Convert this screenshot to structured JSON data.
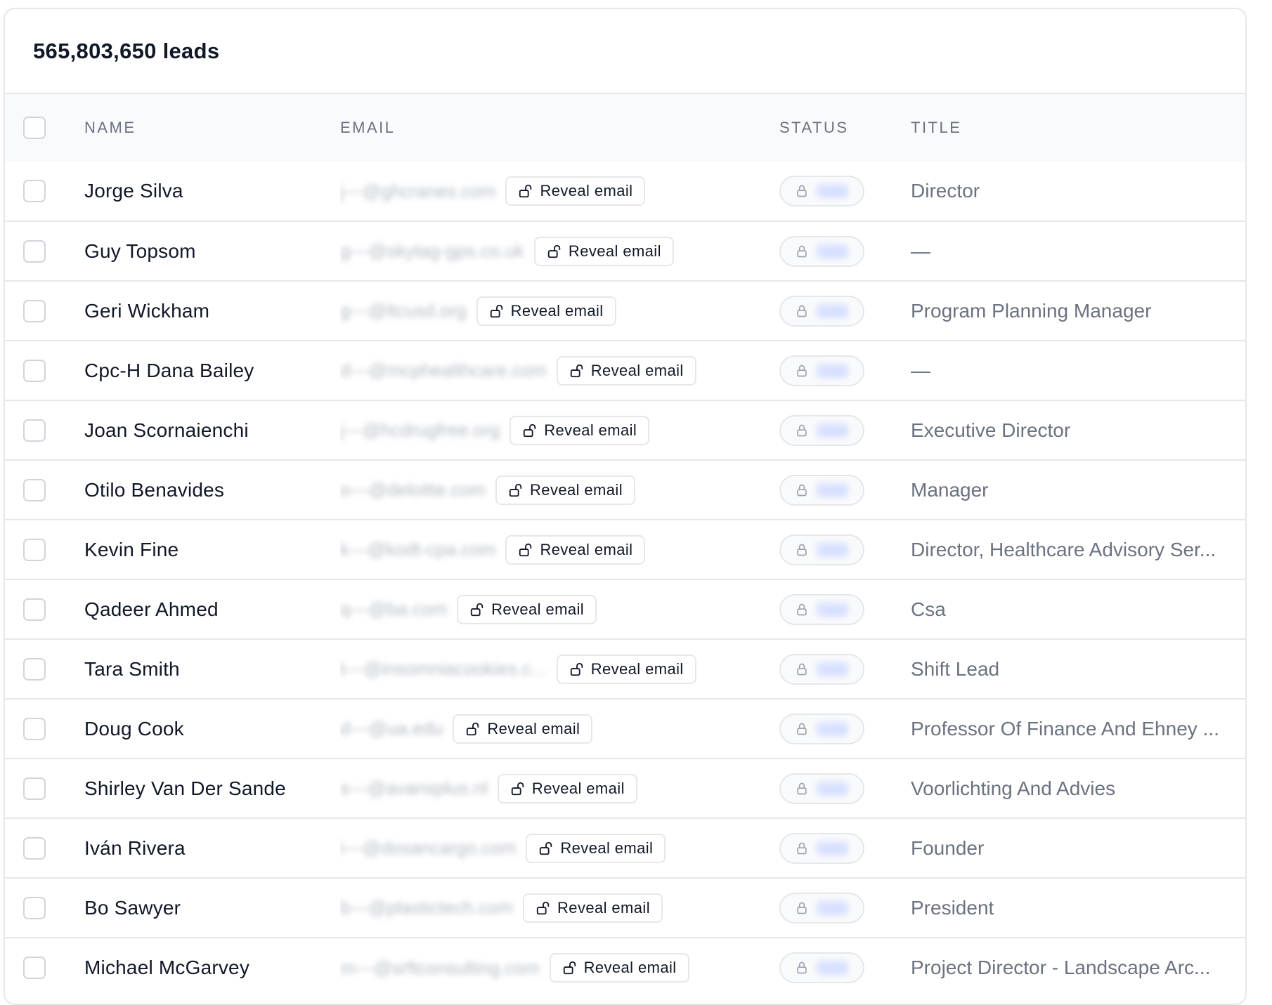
{
  "header": {
    "lead_count": "565,803,650 leads"
  },
  "columns": {
    "name": "NAME",
    "email": "EMAIL",
    "status": "STATUS",
    "title": "TITLE"
  },
  "reveal_label": "Reveal email",
  "rows": [
    {
      "name": "Jorge Silva",
      "email": "j---@ghcranes.com",
      "status": "Valid",
      "title": "Director"
    },
    {
      "name": "Guy Topsom",
      "email": "g---@skytag-gps.co.uk",
      "status": "Valid",
      "title": "—"
    },
    {
      "name": "Geri Wickham",
      "email": "g---@ltcusd.org",
      "status": "Valid",
      "title": "Program Planning Manager"
    },
    {
      "name": "Cpc-H Dana Bailey",
      "email": "d---@mcphealthcare.com",
      "status": "Valid",
      "title": "—"
    },
    {
      "name": "Joan Scornaienchi",
      "email": "j---@hcdrugfree.org",
      "status": "Valid",
      "title": "Executive Director"
    },
    {
      "name": "Otilo Benavides",
      "email": "o---@deloitte.com",
      "status": "Valid",
      "title": "Manager"
    },
    {
      "name": "Kevin Fine",
      "email": "k---@kodt-cpa.com",
      "status": "Valid",
      "title": "Director, Healthcare Advisory Ser..."
    },
    {
      "name": "Qadeer Ahmed",
      "email": "q---@ba.com",
      "status": "Valid",
      "title": "Csa"
    },
    {
      "name": "Tara Smith",
      "email": "t---@insomniacookies.c...",
      "status": "Valid",
      "title": "Shift Lead"
    },
    {
      "name": "Doug Cook",
      "email": "d---@ua.edu",
      "status": "Valid",
      "title": "Professor Of Finance And Ehney ..."
    },
    {
      "name": "Shirley Van Der Sande",
      "email": "s---@avansplus.nl",
      "status": "Valid",
      "title": "Voorlichting And Advies"
    },
    {
      "name": "Iván Rivera",
      "email": "i---@dosancargo.com",
      "status": "Valid",
      "title": "Founder"
    },
    {
      "name": "Bo Sawyer",
      "email": "b---@plastictech.com",
      "status": "Valid",
      "title": "President"
    },
    {
      "name": "Michael McGarvey",
      "email": "m---@srftconsulting.com",
      "status": "Valid",
      "title": "Project Director - Landscape Arc..."
    }
  ]
}
